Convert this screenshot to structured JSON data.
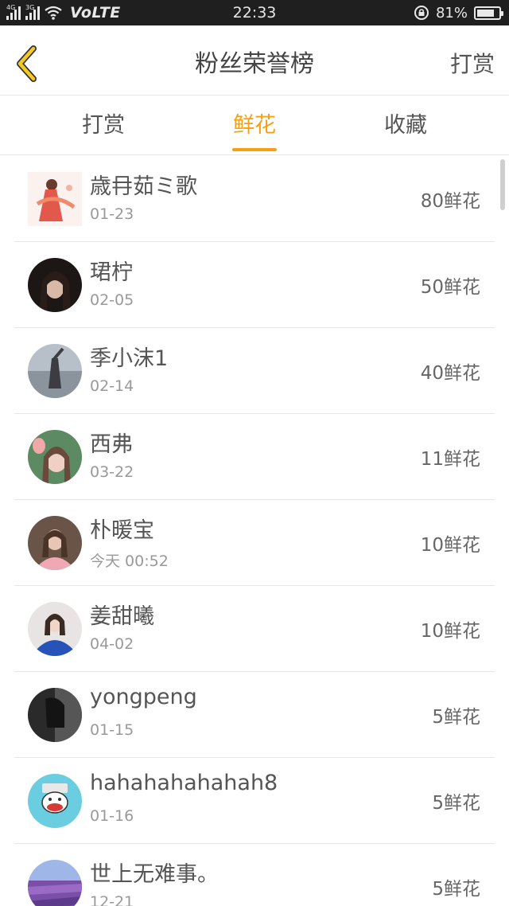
{
  "status_bar": {
    "network_1": "4G",
    "network_2": "3G",
    "carrier_label": "VoLTE",
    "time": "22:33",
    "battery_percent": "81%",
    "battery_level": 0.81
  },
  "header": {
    "title": "粉丝荣誉榜",
    "action_label": "打赏"
  },
  "tabs": [
    {
      "label": "打赏",
      "active": false
    },
    {
      "label": "鲜花",
      "active": true
    },
    {
      "label": "收藏",
      "active": false
    }
  ],
  "accent_color": "#f5a015",
  "list": [
    {
      "name": "歳冄茹ミ歌",
      "date": "01-23",
      "count": "80鲜花"
    },
    {
      "name": "珺柠",
      "date": "02-05",
      "count": "50鲜花"
    },
    {
      "name": "季小沫1",
      "date": "02-14",
      "count": "40鲜花"
    },
    {
      "name": "西弗",
      "date": "03-22",
      "count": "11鲜花"
    },
    {
      "name": "朴暖宝",
      "date": "今天 00:52",
      "count": "10鲜花"
    },
    {
      "name": "姜甜曦",
      "date": "04-02",
      "count": "10鲜花"
    },
    {
      "name": "yongpeng",
      "date": "01-15",
      "count": "5鲜花"
    },
    {
      "name": "hahahahahahah8",
      "date": "01-16",
      "count": "5鲜花"
    },
    {
      "name": "世上无难事。",
      "date": "12-21",
      "count": "5鲜花"
    }
  ]
}
